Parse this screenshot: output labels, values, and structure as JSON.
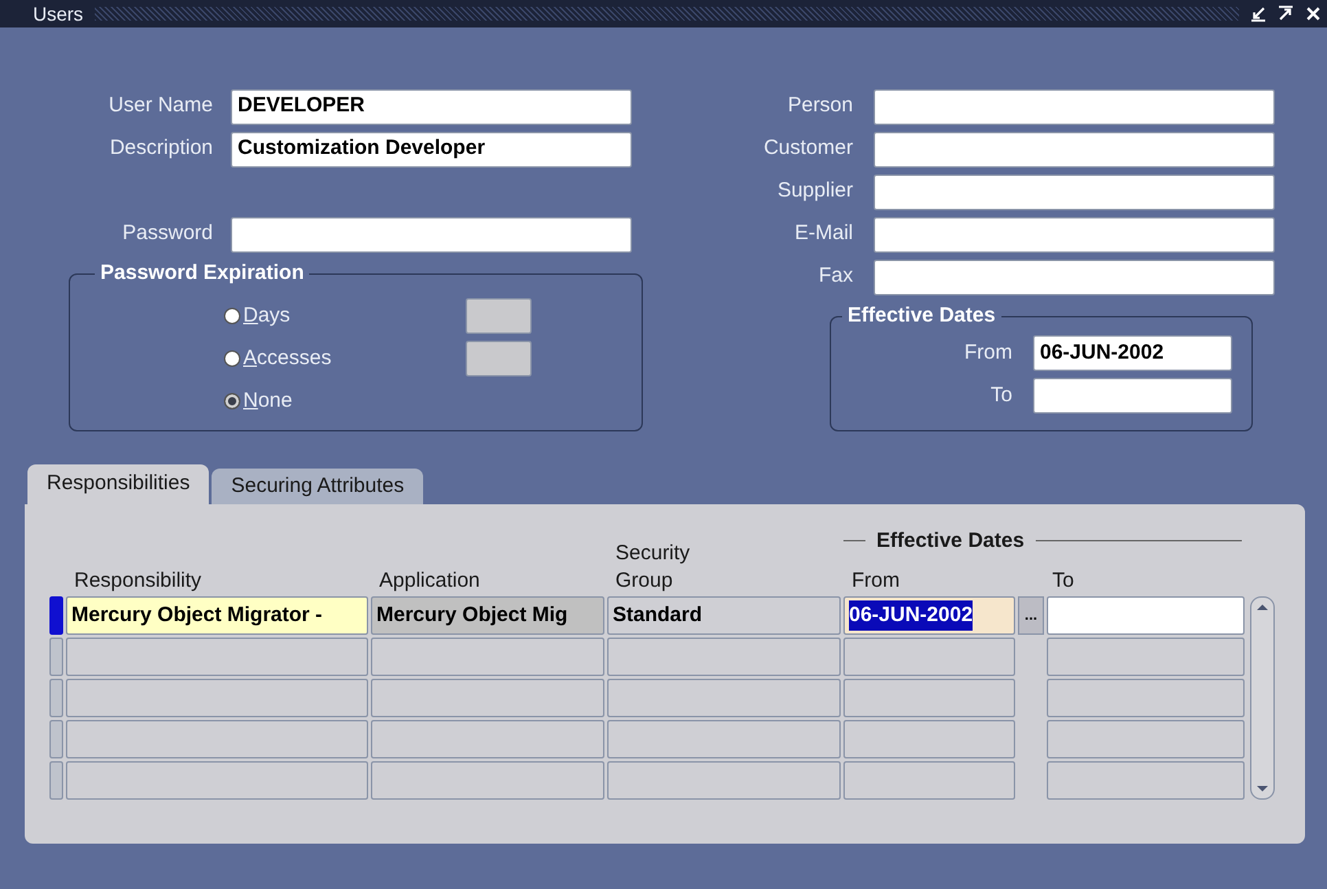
{
  "window": {
    "title": "Users"
  },
  "left_fields": [
    {
      "label": "User Name",
      "value": "DEVELOPER"
    },
    {
      "label": "Description",
      "value": "Customization Developer"
    }
  ],
  "password": {
    "label": "Password"
  },
  "password_expiration": {
    "title": "Password Expiration",
    "options": [
      {
        "label": "Days",
        "selected": false,
        "field": {
          "disabled": true
        }
      },
      {
        "label": "Accesses",
        "selected": false,
        "field": {
          "disabled": true
        }
      },
      {
        "label": "None",
        "selected": true
      }
    ]
  },
  "right_fields": [
    {
      "label": "Person"
    },
    {
      "label": "Customer"
    },
    {
      "label": "Supplier"
    },
    {
      "label": "E-Mail"
    },
    {
      "label": "Fax"
    }
  ],
  "effective_dates": {
    "title": "Effective Dates",
    "from": {
      "label": "From",
      "value": "06-JUN-2002"
    },
    "to": {
      "label": "To"
    }
  },
  "tabs": [
    {
      "label": "Responsibilities",
      "selected": true
    },
    {
      "label": "Securing Attributes",
      "selected": false
    }
  ],
  "table": {
    "group_header": "Effective Dates",
    "columns": [
      {
        "label": "Responsibility"
      },
      {
        "label": "Application"
      },
      {
        "label": "Security Group"
      },
      {
        "label": "From"
      },
      {
        "label": "To"
      }
    ],
    "rows": [
      {
        "selected": true,
        "lov_button": "...",
        "cells": [
          {
            "text": "Mercury Object Migrator -",
            "kind": "required"
          },
          {
            "text": "Mercury Object Mig",
            "kind": "readonly"
          },
          {
            "text": "Standard",
            "kind": "plain"
          },
          {
            "text": "06-JUN-2002",
            "kind": "highlighted"
          },
          {
            "kind": "input"
          }
        ]
      },
      {
        "selected": false
      },
      {
        "selected": false
      },
      {
        "selected": false
      },
      {
        "selected": false
      }
    ]
  }
}
